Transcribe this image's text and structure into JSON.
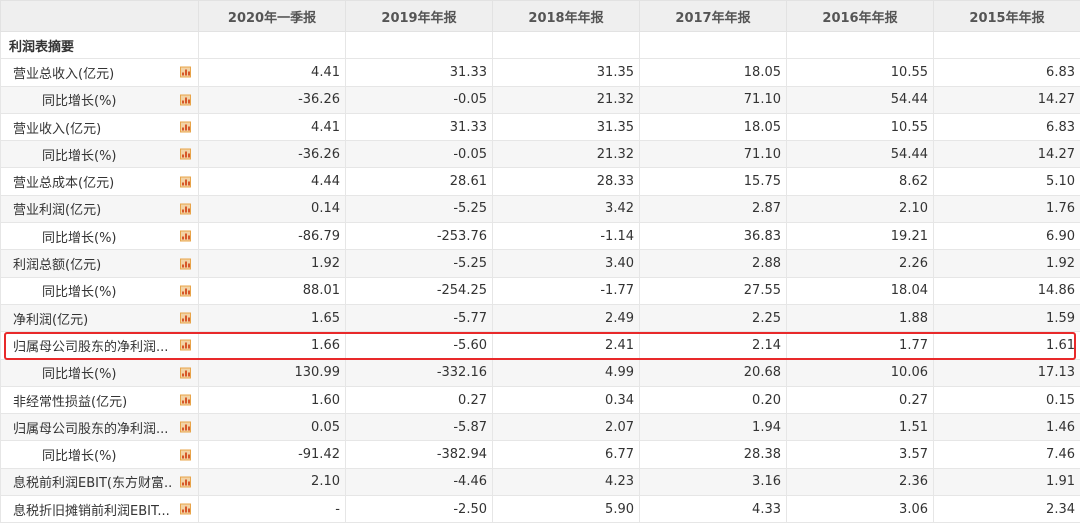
{
  "header": {
    "columns": [
      "",
      "2020年一季报",
      "2019年年报",
      "2018年年报",
      "2017年年报",
      "2016年年报",
      "2015年年报"
    ]
  },
  "section_title": "利润表摘要",
  "rows": [
    {
      "label": "营业总收入(亿元)",
      "indent": false,
      "values": [
        "4.41",
        "31.33",
        "31.35",
        "18.05",
        "10.55",
        "6.83"
      ]
    },
    {
      "label": "同比增长(%)",
      "indent": true,
      "values": [
        "-36.26",
        "-0.05",
        "21.32",
        "71.10",
        "54.44",
        "14.27"
      ]
    },
    {
      "label": "营业收入(亿元)",
      "indent": false,
      "values": [
        "4.41",
        "31.33",
        "31.35",
        "18.05",
        "10.55",
        "6.83"
      ]
    },
    {
      "label": "同比增长(%)",
      "indent": true,
      "values": [
        "-36.26",
        "-0.05",
        "21.32",
        "71.10",
        "54.44",
        "14.27"
      ]
    },
    {
      "label": "营业总成本(亿元)",
      "indent": false,
      "values": [
        "4.44",
        "28.61",
        "28.33",
        "15.75",
        "8.62",
        "5.10"
      ]
    },
    {
      "label": "营业利润(亿元)",
      "indent": false,
      "values": [
        "0.14",
        "-5.25",
        "3.42",
        "2.87",
        "2.10",
        "1.76"
      ]
    },
    {
      "label": "同比增长(%)",
      "indent": true,
      "values": [
        "-86.79",
        "-253.76",
        "-1.14",
        "36.83",
        "19.21",
        "6.90"
      ]
    },
    {
      "label": "利润总额(亿元)",
      "indent": false,
      "values": [
        "1.92",
        "-5.25",
        "3.40",
        "2.88",
        "2.26",
        "1.92"
      ]
    },
    {
      "label": "同比增长(%)",
      "indent": true,
      "values": [
        "88.01",
        "-254.25",
        "-1.77",
        "27.55",
        "18.04",
        "14.86"
      ]
    },
    {
      "label": "净利润(亿元)",
      "indent": false,
      "values": [
        "1.65",
        "-5.77",
        "2.49",
        "2.25",
        "1.88",
        "1.59"
      ]
    },
    {
      "label": "归属母公司股东的净利润...",
      "indent": false,
      "highlight": true,
      "values": [
        "1.66",
        "-5.60",
        "2.41",
        "2.14",
        "1.77",
        "1.61"
      ]
    },
    {
      "label": "同比增长(%)",
      "indent": true,
      "values": [
        "130.99",
        "-332.16",
        "4.99",
        "20.68",
        "10.06",
        "17.13"
      ]
    },
    {
      "label": "非经常性损益(亿元)",
      "indent": false,
      "values": [
        "1.60",
        "0.27",
        "0.34",
        "0.20",
        "0.27",
        "0.15"
      ]
    },
    {
      "label": "归属母公司股东的净利润...",
      "indent": false,
      "values": [
        "0.05",
        "-5.87",
        "2.07",
        "1.94",
        "1.51",
        "1.46"
      ]
    },
    {
      "label": "同比增长(%)",
      "indent": true,
      "values": [
        "-91.42",
        "-382.94",
        "6.77",
        "28.38",
        "3.57",
        "7.46"
      ]
    },
    {
      "label": "息税前利润EBIT(东方财富...",
      "indent": false,
      "values": [
        "2.10",
        "-4.46",
        "4.23",
        "3.16",
        "2.36",
        "1.91"
      ]
    },
    {
      "label": "息税折旧摊销前利润EBIT...",
      "indent": false,
      "values": [
        "-",
        "-2.50",
        "5.90",
        "4.33",
        "3.06",
        "2.34"
      ]
    }
  ],
  "colors": {
    "header_bg": "#efefef",
    "row_alt_bg": "#f6f6f6",
    "highlight_border": "#e8292a",
    "chart_icon_bar": "#d6572a"
  },
  "icons": {
    "row_chart": "bar-chart-icon"
  }
}
